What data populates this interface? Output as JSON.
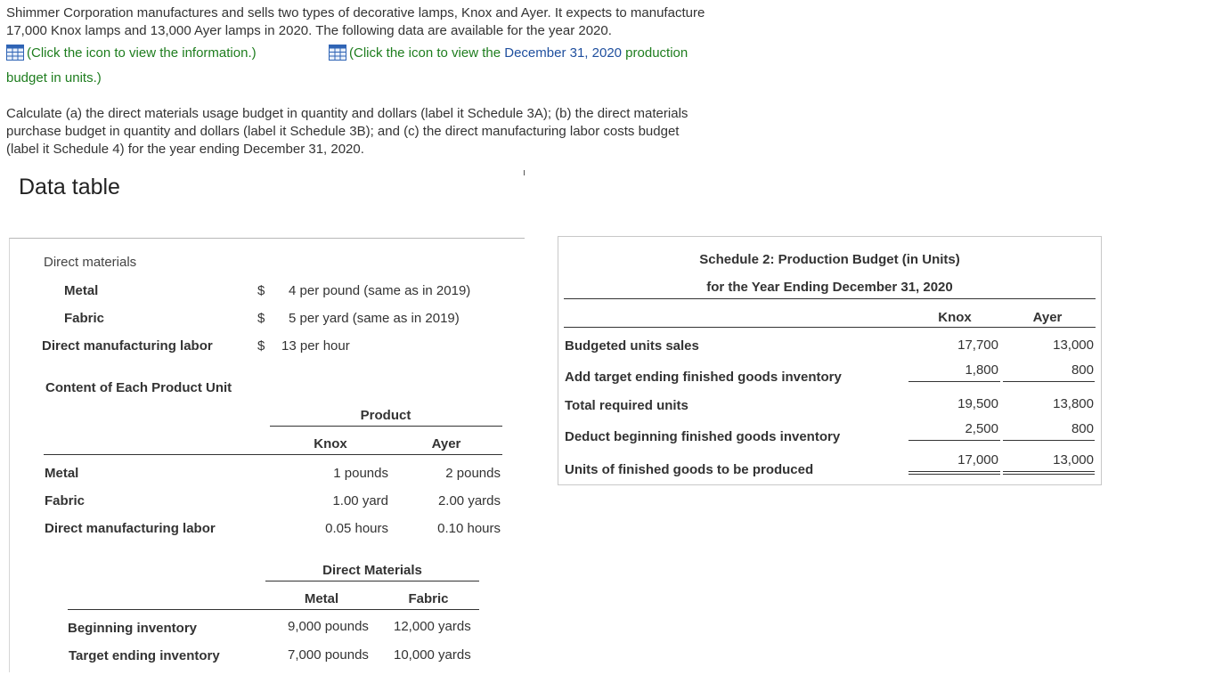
{
  "intro": {
    "line1": "Shimmer Corporation manufactures and sells two types of decorative lamps, Knox and Ayer. It expects to manufacture",
    "line2": "17,000 Knox lamps and 13,000 Ayer lamps in 2020. The following data are available for the year 2020."
  },
  "links": {
    "info": "(Click the icon to view the information.)",
    "prod_a": "(Click the icon to view the ",
    "prod_b": "December 31, 2020",
    "prod_c": " production",
    "prod_d": "budget in units.)"
  },
  "question": {
    "line1": "Calculate (a) the direct materials usage budget in quantity and dollars (label it Schedule 3A); (b) the direct materials",
    "line2": "purchase budget in quantity and dollars (label it Schedule 3B); and (c) the direct manufacturing labor costs budget",
    "line3": "(label it Schedule 4) for the year ending December 31, 2020."
  },
  "data_table": {
    "title": "Data table",
    "direct_materials_label": "Direct materials",
    "rates": [
      {
        "label": "Metal",
        "currency": "$",
        "value": "4 per pound (same as in 2019)"
      },
      {
        "label": "Fabric",
        "currency": "$",
        "value": "5 per yard (same as in 2019)"
      },
      {
        "label": "Direct manufacturing labor",
        "currency": "$",
        "value": "13 per hour"
      }
    ],
    "content_title": "Content of Each Product Unit",
    "product_header": "Product",
    "product_cols": [
      "Knox",
      "Ayer"
    ],
    "content_rows": [
      {
        "label": "Metal",
        "knox": "1 pounds",
        "ayer": "2 pounds"
      },
      {
        "label": "Fabric",
        "knox": "1.00 yard",
        "ayer": "2.00 yards"
      },
      {
        "label": "Direct manufacturing labor",
        "knox": "0.05 hours",
        "ayer": "0.10 hours"
      }
    ],
    "dm_header": "Direct Materials",
    "dm_cols": [
      "Metal",
      "Fabric"
    ],
    "inventory_rows": [
      {
        "label": "Beginning inventory",
        "metal": "9,000 pounds",
        "fabric": "12,000 yards"
      },
      {
        "label": "Target ending inventory",
        "metal": "7,000 pounds",
        "fabric": "10,000 yards"
      }
    ]
  },
  "schedule2": {
    "title1": "Schedule 2: Production Budget (in Units)",
    "title2": "for the Year Ending December 31, 2020",
    "cols": [
      "Knox",
      "Ayer"
    ],
    "rows": [
      {
        "label": "Budgeted units sales",
        "knox": "17,700",
        "ayer": "13,000"
      },
      {
        "label": "Add target ending finished goods inventory",
        "knox": "1,800",
        "ayer": "800"
      },
      {
        "label": "Total required units",
        "knox": "19,500",
        "ayer": "13,800"
      },
      {
        "label": "Deduct beginning finished goods inventory",
        "knox": "2,500",
        "ayer": "800"
      },
      {
        "label": "Units of finished goods to be produced",
        "knox": "17,000",
        "ayer": "13,000"
      }
    ]
  }
}
